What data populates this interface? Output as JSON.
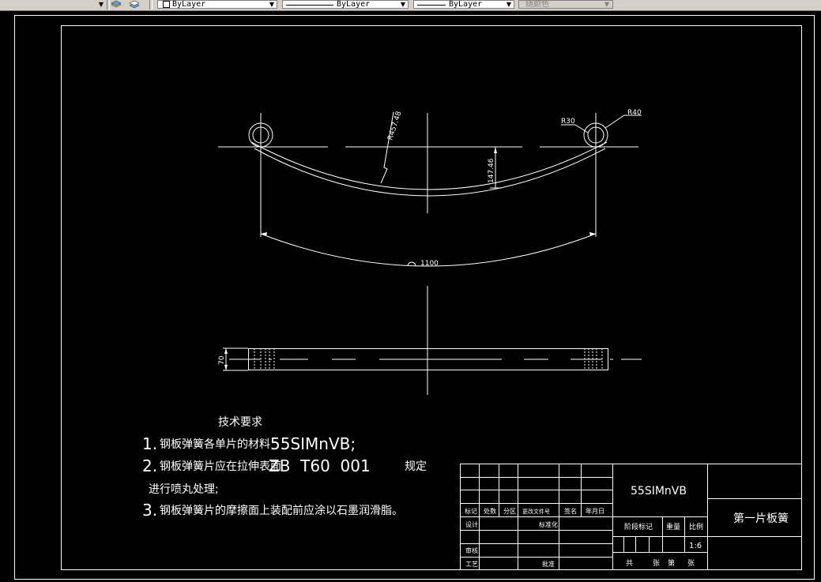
{
  "toolbar": {
    "layer_value": "ByLayer",
    "linetype_value": "ByLayer",
    "lineweight_value": "ByLayer",
    "plotstyle_value": "随颜色"
  },
  "drawing": {
    "dimensions": {
      "radius_main": "R457.48",
      "height": "147.46",
      "radius_eye_inner": "R30",
      "radius_eye_outer": "R40",
      "span": "1100",
      "width": "70"
    },
    "tech_requirements": {
      "title": "技术要求",
      "line1_num": "1.",
      "line1_text": "钢板弹簧各单片的材料",
      "line1_material": "55SIMnVB;",
      "line2_num": "2.",
      "line2_text": "钢板弹簧片应在拉伸表面",
      "line2_std": "ZB  T60  001",
      "line2_tail": "规定",
      "line2_cont": "进行喷丸处理;",
      "line3_num": "3.",
      "line3_text": "钢板弹簧片的摩擦面上装配前应涂以石墨润滑脂。"
    },
    "title_block": {
      "material": "55SIMnVB",
      "part_name": "第一片板簧",
      "h_biaoji": "标记",
      "h_chushu": "处数",
      "h_fenqu": "分区",
      "h_gengai": "更改文件号",
      "h_qianming": "签名",
      "h_riqi": "年月日",
      "h_sheji": "设计",
      "h_biaozhunhua": "标准化",
      "h_shenhe": "审核",
      "h_gongyi": "工艺",
      "h_pizhun": "批准",
      "h_jieduan": "阶段标记",
      "h_zhongliang": "重量",
      "h_bili": "比例",
      "scale": "1:6",
      "sheet_gong": "共",
      "sheet_zhang1": "张",
      "sheet_di": "第",
      "sheet_zhang2": "张"
    }
  },
  "colors": {
    "background": "#000000",
    "lines": "#ffffff",
    "toolbar": "#d4d0c8"
  }
}
